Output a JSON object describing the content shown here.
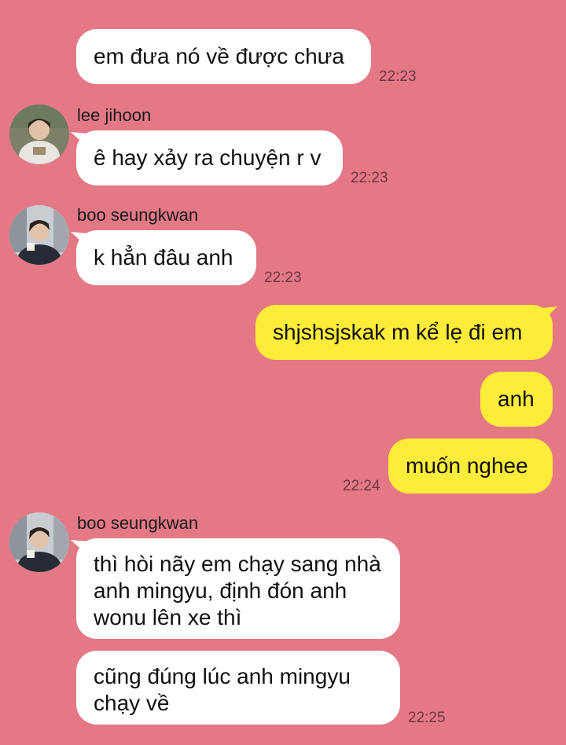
{
  "chat": {
    "messages": [
      {
        "text": "em đưa nó về được chưa",
        "time": "22:23"
      },
      {
        "sender": "lee jihoon",
        "text": "ê hay xảy ra chuyện r v",
        "time": "22:23"
      },
      {
        "sender": "boo seungkwan",
        "text": "k hẳn đâu anh",
        "time": "22:23"
      },
      {
        "text": "shjshsjskak m kể lẹ đi em"
      },
      {
        "text": "anh"
      },
      {
        "text": "muốn nghee",
        "time": "22:24"
      },
      {
        "sender": "boo seungkwan",
        "text": "thì hòi nãy em chạy sang nhà anh mingyu, định đón anh wonu lên xe thì"
      },
      {
        "text": "cũng đúng lúc anh mingyu chạy về",
        "time": "22:25"
      }
    ]
  },
  "colors": {
    "background": "#e47885",
    "incoming_bubble": "#ffffff",
    "outgoing_bubble": "#fdec3a"
  }
}
